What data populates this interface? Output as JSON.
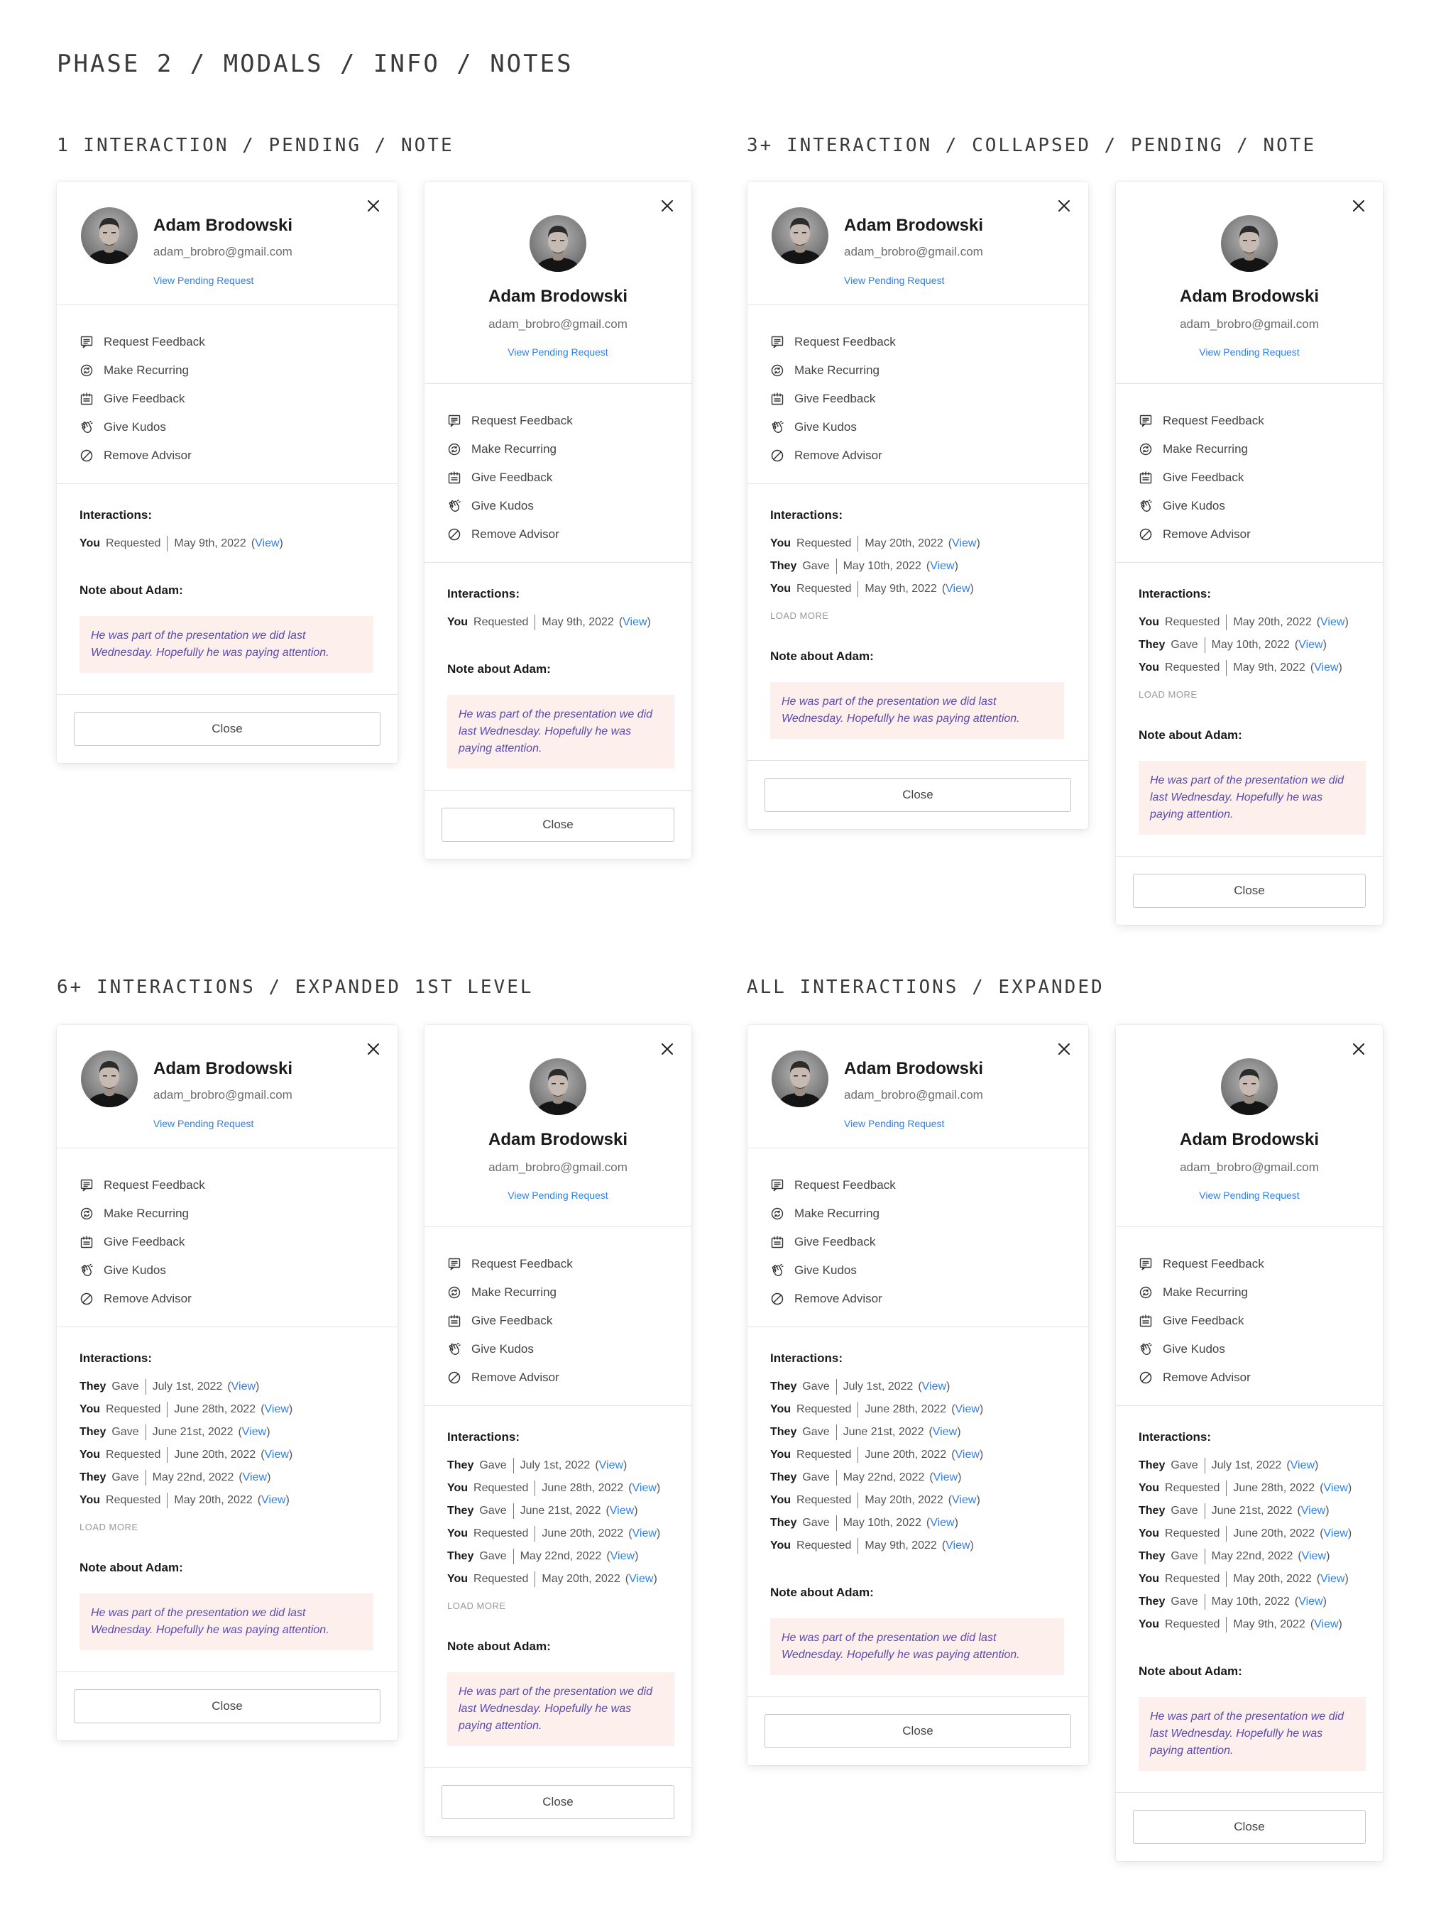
{
  "page_title": "PHASE 2 / MODALS / INFO / NOTES",
  "sections": [
    {
      "title": "1 INTERACTION / PENDING / NOTE"
    },
    {
      "title": "3+ INTERACTION / COLLAPSED / PENDING / NOTE"
    },
    {
      "title": "6+ INTERACTIONS / EXPANDED 1ST LEVEL"
    },
    {
      "title": "ALL INTERACTIONS / EXPANDED"
    }
  ],
  "profile": {
    "name": "Adam Brodowski",
    "email": "adam_brobro@gmail.com",
    "pending_link": "View Pending Request"
  },
  "actions": [
    {
      "label": "Request Feedback",
      "icon": "request-feedback-icon"
    },
    {
      "label": "Make Recurring",
      "icon": "recurring-icon"
    },
    {
      "label": "Give Feedback",
      "icon": "give-feedback-icon"
    },
    {
      "label": "Give Kudos",
      "icon": "kudos-hand-icon"
    },
    {
      "label": "Remove Advisor",
      "icon": "remove-icon"
    }
  ],
  "interactions_heading": "Interactions:",
  "note_heading": "Note about Adam:",
  "note_text": "He was part of the presentation we did last Wednesday. Hopefully he was paying attention.",
  "load_more": "LOAD MORE",
  "close_label": "Close",
  "view_label": "View",
  "interaction_sets": {
    "one": [
      {
        "who": "You",
        "action": "Requested",
        "date": "May 9th, 2022"
      }
    ],
    "three": [
      {
        "who": "You",
        "action": "Requested",
        "date": "May 20th, 2022"
      },
      {
        "who": "They",
        "action": "Gave",
        "date": "May 10th, 2022"
      },
      {
        "who": "You",
        "action": "Requested",
        "date": "May 9th, 2022"
      }
    ],
    "six": [
      {
        "who": "They",
        "action": "Gave",
        "date": "July 1st, 2022"
      },
      {
        "who": "You",
        "action": "Requested",
        "date": "June 28th, 2022"
      },
      {
        "who": "They",
        "action": "Gave",
        "date": "June 21st, 2022"
      },
      {
        "who": "You",
        "action": "Requested",
        "date": "June 20th, 2022"
      },
      {
        "who": "They",
        "action": "Gave",
        "date": "May 22nd, 2022"
      },
      {
        "who": "You",
        "action": "Requested",
        "date": "May 20th, 2022"
      }
    ],
    "all": [
      {
        "who": "They",
        "action": "Gave",
        "date": "July 1st, 2022"
      },
      {
        "who": "You",
        "action": "Requested",
        "date": "June 28th, 2022"
      },
      {
        "who": "They",
        "action": "Gave",
        "date": "June 21st, 2022"
      },
      {
        "who": "You",
        "action": "Requested",
        "date": "June 20th, 2022"
      },
      {
        "who": "They",
        "action": "Gave",
        "date": "May 22nd, 2022"
      },
      {
        "who": "You",
        "action": "Requested",
        "date": "May 20th, 2022"
      },
      {
        "who": "They",
        "action": "Gave",
        "date": "May 10th, 2022"
      },
      {
        "who": "You",
        "action": "Requested",
        "date": "May 9th, 2022"
      }
    ]
  },
  "modals": [
    {
      "variant": "wide",
      "set": "one",
      "load_more": false
    },
    {
      "variant": "narrow",
      "set": "one",
      "load_more": false
    },
    {
      "variant": "wide",
      "set": "three",
      "load_more": true
    },
    {
      "variant": "narrow",
      "set": "three",
      "load_more": true
    },
    {
      "variant": "wide",
      "set": "six",
      "load_more": true
    },
    {
      "variant": "narrow",
      "set": "six",
      "load_more": true
    },
    {
      "variant": "wide",
      "set": "all",
      "load_more": false
    },
    {
      "variant": "narrow",
      "set": "all",
      "load_more": false
    }
  ],
  "colors": {
    "link": "#2f80ed",
    "note_bg": "#fdefeb",
    "note_text": "#5a4ab3"
  }
}
